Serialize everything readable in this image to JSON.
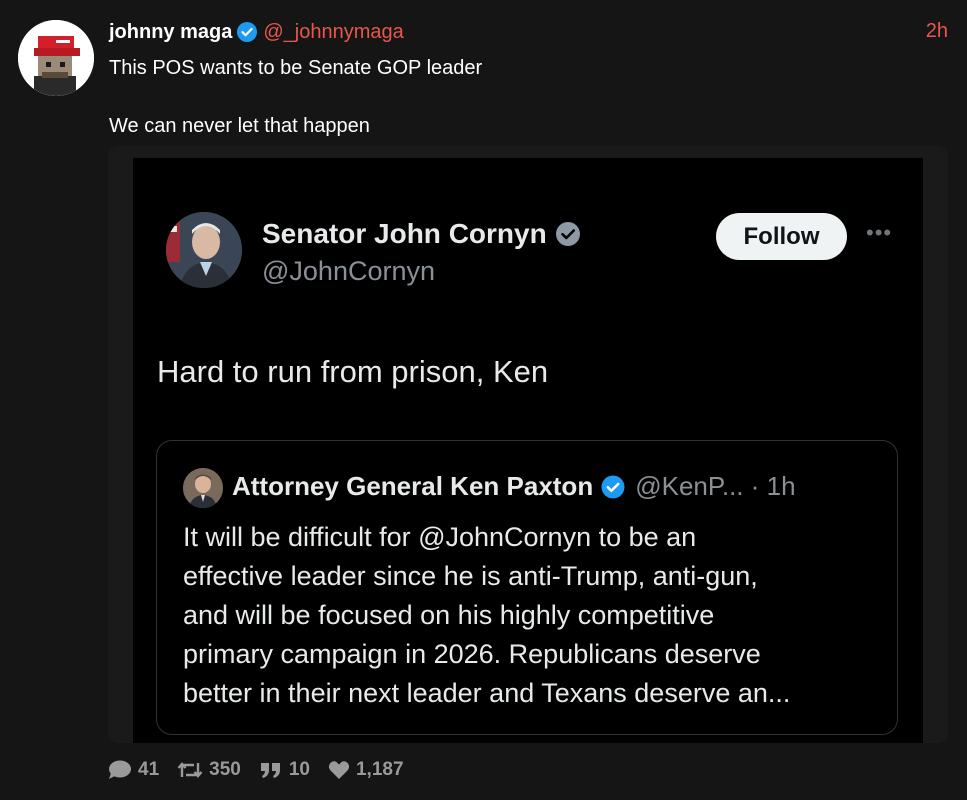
{
  "post": {
    "author_name": "johnny maga",
    "author_handle": "@_johnnymaga",
    "time": "2h",
    "text_line1": "This POS wants to be Senate GOP leader",
    "text_line2": "We can never let that happen",
    "verified_icon": "verified-badge-icon"
  },
  "embedded_tweet": {
    "author_name": "Senator John Cornyn",
    "author_handle": "@JohnCornyn",
    "follow_label": "Follow",
    "more_label": "•••",
    "text": "Hard to run from prison, Ken",
    "quote": {
      "author_name": "Attorney General Ken Paxton",
      "handle_time": "@KenP... · 1h",
      "lines": [
        "It will be difficult for @JohnCornyn to be an",
        "effective leader since he is anti-Trump, anti-gun,",
        "and will be focused on his highly competitive",
        "primary campaign in 2026. Republicans deserve",
        "better in their next leader and Texans deserve an..."
      ]
    }
  },
  "stats": {
    "replies": "41",
    "reposts": "350",
    "quotes": "10",
    "likes": "1,187"
  },
  "colors": {
    "background": "#151515",
    "accent": "#e8574a",
    "verified": "#1d9bf0",
    "stat_gray": "#9a9a9a"
  }
}
